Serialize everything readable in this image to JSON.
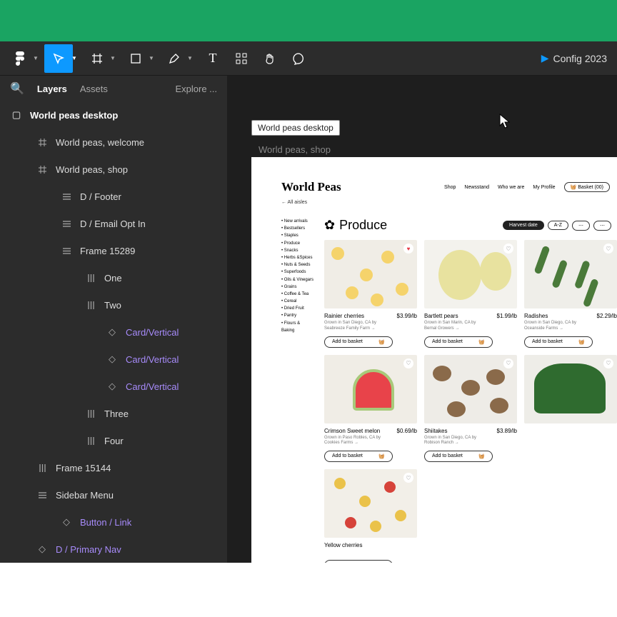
{
  "topright": "Config 2023",
  "sidebar": {
    "tabs": {
      "layers": "Layers",
      "assets": "Assets",
      "explore": "Explore ..."
    },
    "root": "World peas desktop",
    "items": [
      {
        "icon": "#",
        "label": "World peas, welcome",
        "depth": 1
      },
      {
        "icon": "#",
        "label": "World peas, shop",
        "depth": 1
      },
      {
        "icon": "=",
        "label": "D / Footer",
        "depth": 2
      },
      {
        "icon": "=",
        "label": "D / Email Opt In",
        "depth": 2
      },
      {
        "icon": "=",
        "label": "Frame 15289",
        "depth": 2
      },
      {
        "icon": "|",
        "label": "One",
        "depth": 3
      },
      {
        "icon": "|",
        "label": "Two",
        "depth": 3
      },
      {
        "icon": "◇",
        "label": "Card/Vertical",
        "depth": 4,
        "comp": true
      },
      {
        "icon": "◇",
        "label": "Card/Vertical",
        "depth": 4,
        "comp": true
      },
      {
        "icon": "◇",
        "label": "Card/Vertical",
        "depth": 4,
        "comp": true
      },
      {
        "icon": "|",
        "label": "Three",
        "depth": 3
      },
      {
        "icon": "|",
        "label": "Four",
        "depth": 3
      },
      {
        "icon": "|",
        "label": "Frame 15144",
        "depth": 1
      },
      {
        "icon": "=",
        "label": "Sidebar Menu",
        "depth": 1
      },
      {
        "icon": "◇",
        "label": "Button / Link",
        "depth": 2,
        "comp": true
      },
      {
        "icon": "◇",
        "label": "D / Primary Nav",
        "depth": 1,
        "comp": true
      }
    ]
  },
  "canvas": {
    "frame_label": "World peas desktop",
    "section_label": "World peas, shop",
    "brand": "World Peas",
    "nav": [
      "Shop",
      "Newsstand",
      "Who we are",
      "My Profile"
    ],
    "basket": "Basket  (00)",
    "crumb": "← All aisles",
    "sidelist": [
      "New arrivals",
      "Bestsellers",
      "Staples",
      "Produce",
      "",
      "Snacks",
      "Herbs &Spices",
      "Nuts & Seeds",
      "Superfoods",
      "Oils & Vinegars",
      "Grains",
      "Coffee & Tea",
      "Cereal",
      "Dried Fruit",
      "Pantry",
      "Flours & Baking"
    ],
    "category": "Produce",
    "chips": [
      "Harvest date",
      "A-Z",
      "",
      ""
    ],
    "add_label": "Add to basket",
    "cards": [
      {
        "name": "Rainier cherries",
        "price": "$3.99/lb",
        "grown": "Grown in San Diego, CA by",
        "farm": "Seabreeze Family Farm →",
        "cls": "t-cherries",
        "fav": true
      },
      {
        "name": "Bartlett pears",
        "price": "$1.99/lb",
        "grown": "Grown in San Marin, CA by",
        "farm": "Bernal Growers →",
        "cls": "t-pears"
      },
      {
        "name": "Radishes",
        "price": "$2.29/lb",
        "grown": "Grown in San Diego, CA by",
        "farm": "Oceanside Farms →",
        "cls": "t-rad"
      },
      {
        "name": "Crimson Sweet melon",
        "price": "$0.69/lb",
        "grown": "Grown in Paso Robles, CA by",
        "farm": "Cookies Farms →",
        "cls": "t-melon"
      },
      {
        "name": "Shiitakes",
        "price": "$3.89/lb",
        "grown": "Grown in San Diego, CA by",
        "farm": "Robison Ranch →",
        "cls": "t-shii"
      },
      {
        "name": "",
        "price": "",
        "grown": "",
        "farm": "",
        "cls": "t-green"
      },
      {
        "name": "Yellow cherries",
        "price": "",
        "grown": "",
        "farm": "",
        "cls": "t-ycherries"
      }
    ]
  }
}
